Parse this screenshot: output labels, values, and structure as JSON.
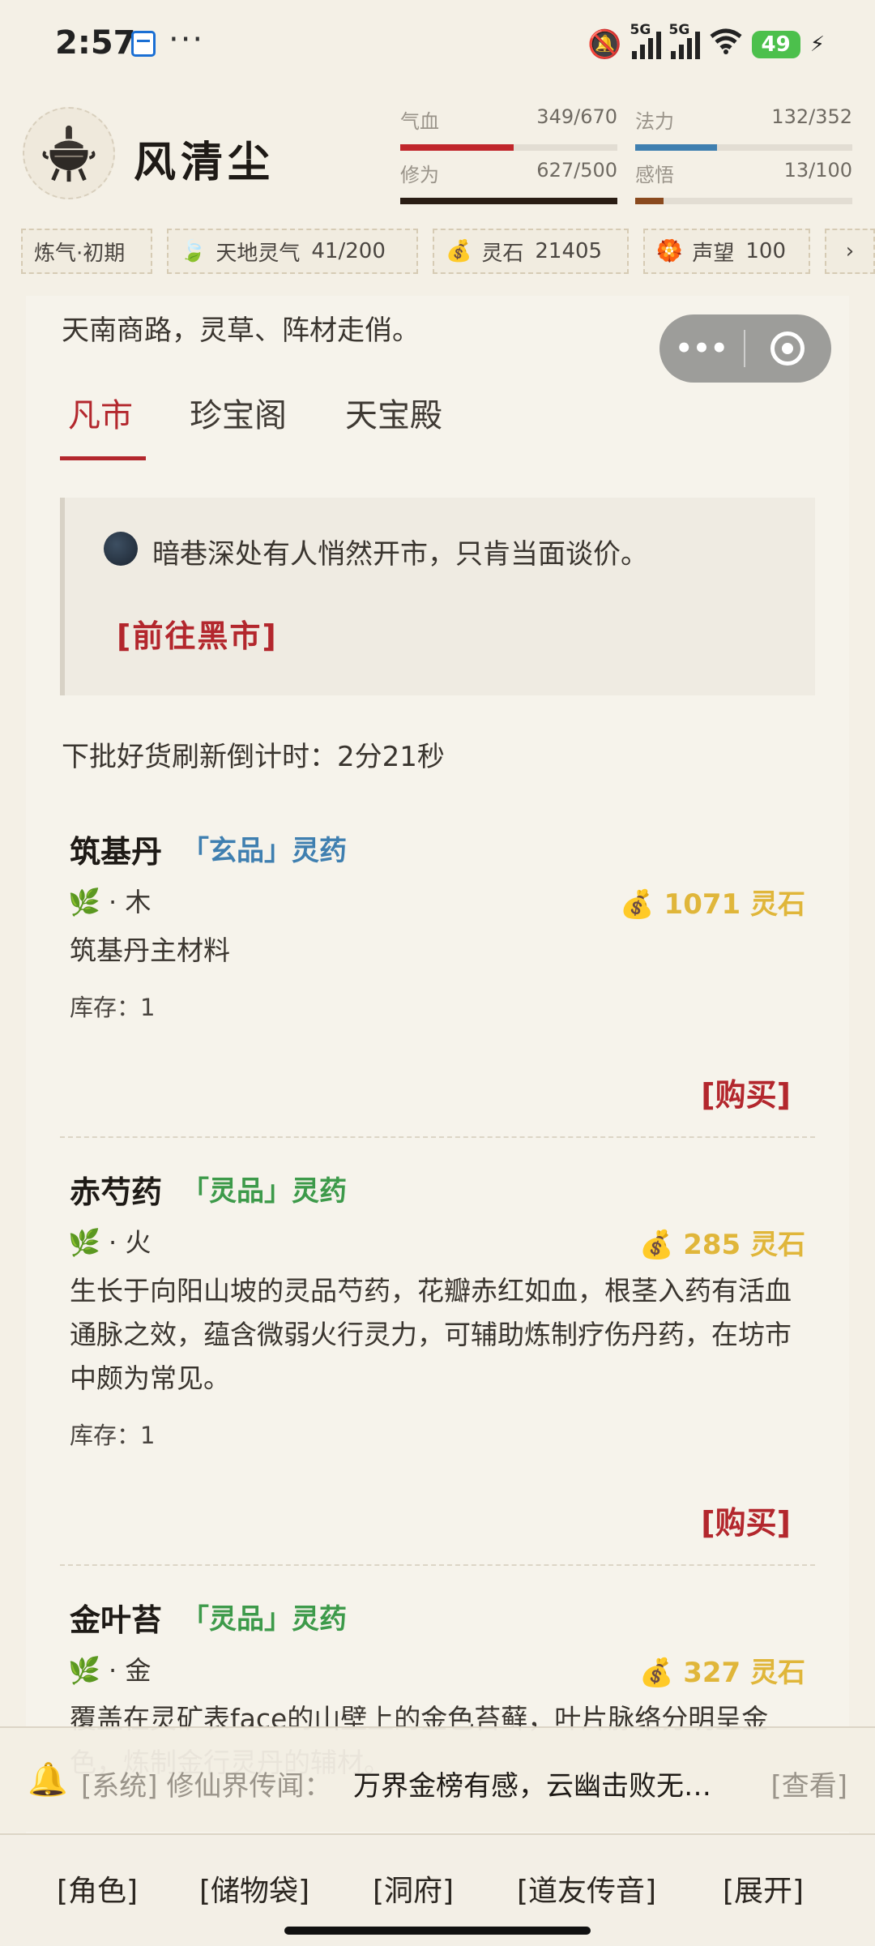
{
  "status_bar": {
    "time": "2:57",
    "more": "···",
    "signal1_tag": "5G",
    "signal2_tag": "5G",
    "battery": "49"
  },
  "player": {
    "name": "风清尘",
    "avatar_icon": "censer-icon",
    "stats": {
      "hp": {
        "label": "气血",
        "value": "349/670",
        "ratio": 0.521,
        "color": "#c0262b"
      },
      "mana": {
        "label": "法力",
        "value": "132/352",
        "ratio": 0.375,
        "color": "#3f7fb0"
      },
      "cultivation": {
        "label": "修为",
        "value": "627/500",
        "ratio": 1.0,
        "color": "#2a1d14"
      },
      "insight": {
        "label": "感悟",
        "value": "13/100",
        "ratio": 0.13,
        "color": "#8a4a1e"
      }
    }
  },
  "chips": {
    "realm": "炼气·初期",
    "qi": {
      "icon": "leaf-icon",
      "label": "天地灵气",
      "value": "41/200"
    },
    "stones": {
      "icon": "money-bag-icon",
      "label": "灵石",
      "value": "21405"
    },
    "fame": {
      "icon": "rosette-icon",
      "label": "声望",
      "value": "100"
    },
    "more": "›"
  },
  "shop": {
    "intro": "天南商路，灵草、阵材走俏。",
    "tabs": [
      "凡市",
      "珍宝阁",
      "天宝殿"
    ],
    "active_tab": 0,
    "notice": {
      "text": "暗巷深处有人悄然开市，只肯当面谈价。",
      "link": "[前往黑市]"
    },
    "countdown": "下批好货刷新倒计时：2分21秒",
    "buy_label": "[购买]",
    "stock_label": "库存：",
    "items": [
      {
        "name": "筑基丹",
        "grade": "「玄品」灵药",
        "grade_color": "#3f7fb0",
        "element": "木",
        "price": "1071 灵石",
        "desc": "筑基丹主材料",
        "stock": "1"
      },
      {
        "name": "赤芍药",
        "grade": "「灵品」灵药",
        "grade_color": "#3d9a4a",
        "element": "火",
        "price": "285 灵石",
        "desc": "生长于向阳山坡的灵品芍药，花瓣赤红如血，根茎入药有活血通脉之效，蕴含微弱火行灵力，可辅助炼制疗伤丹药，在坊市中颇为常见。",
        "stock": "1"
      },
      {
        "name": "金叶苔",
        "grade": "「灵品」灵药",
        "grade_color": "#3d9a4a",
        "element": "金",
        "price": "327 灵石",
        "desc": "覆盖在灵矿表face的山壁上的金色苔藓，叶片脉络分明呈金色，炼制金行灵丹的辅材。",
        "stock": "1"
      }
    ]
  },
  "broadcast": {
    "icon": "bell-icon",
    "label": "[系统] 修仙界传闻：",
    "message": "万界金榜有感，云幽击败无…",
    "view": "[查看]"
  },
  "nav": [
    "[角色]",
    "[储物袋]",
    "[洞府]",
    "[道友传音]",
    "[展开]"
  ]
}
